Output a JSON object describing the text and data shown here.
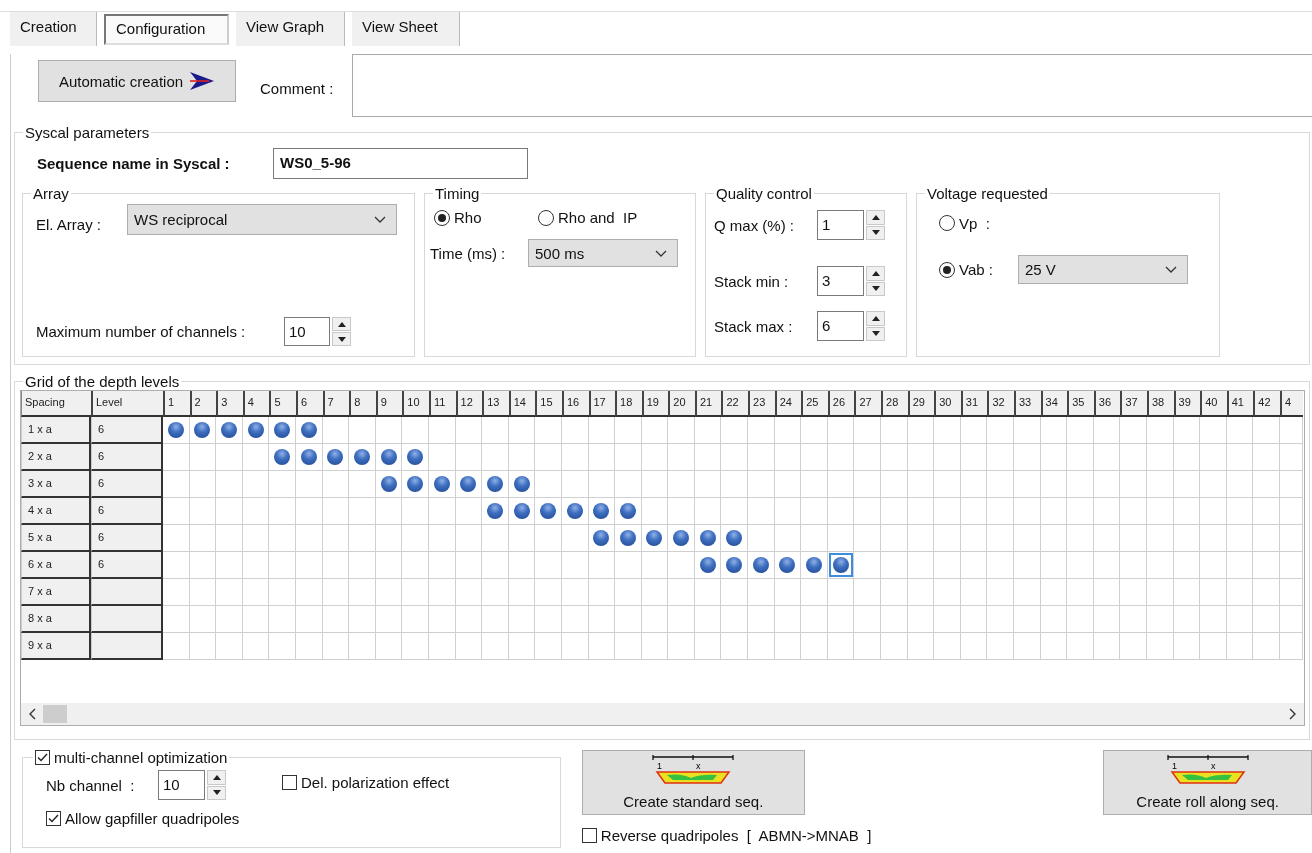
{
  "tabs": [
    {
      "label": "Creation",
      "selected": false
    },
    {
      "label": "Configuration",
      "selected": true
    },
    {
      "label": "View Graph",
      "selected": false
    },
    {
      "label": "View Sheet",
      "selected": false
    }
  ],
  "automatic_button": {
    "label": "Automatic creation"
  },
  "comment": {
    "label": "Comment :"
  },
  "syscal": {
    "title": "Syscal parameters",
    "sequence_label": "Sequence name in Syscal :",
    "sequence_value": "WS0_5-96",
    "array": {
      "title": "Array",
      "el_array_label": "El. Array :",
      "el_array_value": "WS reciprocal",
      "max_channels_label": "Maximum number of channels :",
      "max_channels_value": "10"
    },
    "timing": {
      "title": "Timing",
      "options": [
        {
          "label": "Rho",
          "selected": true
        },
        {
          "label": "Rho and  IP",
          "selected": false
        }
      ],
      "time_label": "Time (ms) :",
      "time_value": "500 ms"
    },
    "quality": {
      "title": "Quality control",
      "fields": [
        {
          "label": "Q max (%) :",
          "value": "1"
        },
        {
          "label": "Stack min :",
          "value": "3"
        },
        {
          "label": "Stack max :",
          "value": "6"
        }
      ]
    },
    "voltage": {
      "title": "Voltage requested",
      "options": [
        {
          "label": "Vp  :",
          "selected": false
        },
        {
          "label": "Vab :",
          "selected": true
        }
      ],
      "vab_value": "25 V"
    }
  },
  "grid": {
    "title": "Grid of the depth levels",
    "columns": [
      "Spacing",
      "Level",
      "1",
      "2",
      "3",
      "4",
      "5",
      "6",
      "7",
      "8",
      "9",
      "10",
      "11",
      "12",
      "13",
      "14",
      "15",
      "16",
      "17",
      "18",
      "19",
      "20",
      "21",
      "22",
      "23",
      "24",
      "25",
      "26",
      "27",
      "28",
      "29",
      "30",
      "31",
      "32",
      "33",
      "34",
      "35",
      "36",
      "37",
      "38",
      "39",
      "40",
      "41",
      "42",
      "4"
    ],
    "rows": [
      {
        "spacing": "1 x a",
        "level": "6",
        "dots": [
          true,
          true,
          true,
          true,
          true,
          true,
          false,
          false,
          false,
          false,
          false,
          false,
          false,
          false,
          false,
          false,
          false,
          false,
          false,
          false,
          false,
          false,
          false,
          false,
          false,
          false,
          false,
          false,
          false,
          false,
          false,
          false,
          false,
          false,
          false,
          false,
          false,
          false,
          false,
          false,
          false,
          false,
          false
        ],
        "selected": [
          false,
          false,
          false,
          false,
          false,
          false,
          false,
          false,
          false,
          false,
          false,
          false,
          false,
          false,
          false,
          false,
          false,
          false,
          false,
          false,
          false,
          false,
          false,
          false,
          false,
          false,
          false,
          false,
          false,
          false,
          false,
          false,
          false,
          false,
          false,
          false,
          false,
          false,
          false,
          false,
          false,
          false,
          false
        ]
      },
      {
        "spacing": "2 x a",
        "level": "6",
        "dots": [
          false,
          false,
          false,
          false,
          true,
          true,
          true,
          true,
          true,
          true,
          false,
          false,
          false,
          false,
          false,
          false,
          false,
          false,
          false,
          false,
          false,
          false,
          false,
          false,
          false,
          false,
          false,
          false,
          false,
          false,
          false,
          false,
          false,
          false,
          false,
          false,
          false,
          false,
          false,
          false,
          false,
          false,
          false
        ],
        "selected": [
          false,
          false,
          false,
          false,
          false,
          false,
          false,
          false,
          false,
          false,
          false,
          false,
          false,
          false,
          false,
          false,
          false,
          false,
          false,
          false,
          false,
          false,
          false,
          false,
          false,
          false,
          false,
          false,
          false,
          false,
          false,
          false,
          false,
          false,
          false,
          false,
          false,
          false,
          false,
          false,
          false,
          false,
          false
        ]
      },
      {
        "spacing": "3 x a",
        "level": "6",
        "dots": [
          false,
          false,
          false,
          false,
          false,
          false,
          false,
          false,
          true,
          true,
          true,
          true,
          true,
          true,
          false,
          false,
          false,
          false,
          false,
          false,
          false,
          false,
          false,
          false,
          false,
          false,
          false,
          false,
          false,
          false,
          false,
          false,
          false,
          false,
          false,
          false,
          false,
          false,
          false,
          false,
          false,
          false,
          false
        ],
        "selected": [
          false,
          false,
          false,
          false,
          false,
          false,
          false,
          false,
          false,
          false,
          false,
          false,
          false,
          false,
          false,
          false,
          false,
          false,
          false,
          false,
          false,
          false,
          false,
          false,
          false,
          false,
          false,
          false,
          false,
          false,
          false,
          false,
          false,
          false,
          false,
          false,
          false,
          false,
          false,
          false,
          false,
          false,
          false
        ]
      },
      {
        "spacing": "4 x a",
        "level": "6",
        "dots": [
          false,
          false,
          false,
          false,
          false,
          false,
          false,
          false,
          false,
          false,
          false,
          false,
          true,
          true,
          true,
          true,
          true,
          true,
          false,
          false,
          false,
          false,
          false,
          false,
          false,
          false,
          false,
          false,
          false,
          false,
          false,
          false,
          false,
          false,
          false,
          false,
          false,
          false,
          false,
          false,
          false,
          false,
          false
        ],
        "selected": [
          false,
          false,
          false,
          false,
          false,
          false,
          false,
          false,
          false,
          false,
          false,
          false,
          false,
          false,
          false,
          false,
          false,
          false,
          false,
          false,
          false,
          false,
          false,
          false,
          false,
          false,
          false,
          false,
          false,
          false,
          false,
          false,
          false,
          false,
          false,
          false,
          false,
          false,
          false,
          false,
          false,
          false,
          false
        ]
      },
      {
        "spacing": "5 x a",
        "level": "6",
        "dots": [
          false,
          false,
          false,
          false,
          false,
          false,
          false,
          false,
          false,
          false,
          false,
          false,
          false,
          false,
          false,
          false,
          true,
          true,
          true,
          true,
          true,
          true,
          false,
          false,
          false,
          false,
          false,
          false,
          false,
          false,
          false,
          false,
          false,
          false,
          false,
          false,
          false,
          false,
          false,
          false,
          false,
          false,
          false
        ],
        "selected": [
          false,
          false,
          false,
          false,
          false,
          false,
          false,
          false,
          false,
          false,
          false,
          false,
          false,
          false,
          false,
          false,
          false,
          false,
          false,
          false,
          false,
          false,
          false,
          false,
          false,
          false,
          false,
          false,
          false,
          false,
          false,
          false,
          false,
          false,
          false,
          false,
          false,
          false,
          false,
          false,
          false,
          false,
          false
        ]
      },
      {
        "spacing": "6 x a",
        "level": "6",
        "dots": [
          false,
          false,
          false,
          false,
          false,
          false,
          false,
          false,
          false,
          false,
          false,
          false,
          false,
          false,
          false,
          false,
          false,
          false,
          false,
          false,
          true,
          true,
          true,
          true,
          true,
          true,
          false,
          false,
          false,
          false,
          false,
          false,
          false,
          false,
          false,
          false,
          false,
          false,
          false,
          false,
          false,
          false,
          false
        ],
        "selected": [
          false,
          false,
          false,
          false,
          false,
          false,
          false,
          false,
          false,
          false,
          false,
          false,
          false,
          false,
          false,
          false,
          false,
          false,
          false,
          false,
          false,
          false,
          false,
          false,
          false,
          true,
          false,
          false,
          false,
          false,
          false,
          false,
          false,
          false,
          false,
          false,
          false,
          false,
          false,
          false,
          false,
          false,
          false
        ]
      },
      {
        "spacing": "7 x a",
        "dots": [
          false,
          false,
          false,
          false,
          false,
          false,
          false,
          false,
          false,
          false,
          false,
          false,
          false,
          false,
          false,
          false,
          false,
          false,
          false,
          false,
          false,
          false,
          false,
          false,
          false,
          false,
          false,
          false,
          false,
          false,
          false,
          false,
          false,
          false,
          false,
          false,
          false,
          false,
          false,
          false,
          false,
          false,
          false
        ],
        "selected": [
          false,
          false,
          false,
          false,
          false,
          false,
          false,
          false,
          false,
          false,
          false,
          false,
          false,
          false,
          false,
          false,
          false,
          false,
          false,
          false,
          false,
          false,
          false,
          false,
          false,
          false,
          false,
          false,
          false,
          false,
          false,
          false,
          false,
          false,
          false,
          false,
          false,
          false,
          false,
          false,
          false,
          false,
          false
        ]
      },
      {
        "spacing": "8 x a",
        "dots": [
          false,
          false,
          false,
          false,
          false,
          false,
          false,
          false,
          false,
          false,
          false,
          false,
          false,
          false,
          false,
          false,
          false,
          false,
          false,
          false,
          false,
          false,
          false,
          false,
          false,
          false,
          false,
          false,
          false,
          false,
          false,
          false,
          false,
          false,
          false,
          false,
          false,
          false,
          false,
          false,
          false,
          false,
          false
        ],
        "selected": [
          false,
          false,
          false,
          false,
          false,
          false,
          false,
          false,
          false,
          false,
          false,
          false,
          false,
          false,
          false,
          false,
          false,
          false,
          false,
          false,
          false,
          false,
          false,
          false,
          false,
          false,
          false,
          false,
          false,
          false,
          false,
          false,
          false,
          false,
          false,
          false,
          false,
          false,
          false,
          false,
          false,
          false,
          false
        ]
      },
      {
        "spacing": "9 x a",
        "dots": [
          false,
          false,
          false,
          false,
          false,
          false,
          false,
          false,
          false,
          false,
          false,
          false,
          false,
          false,
          false,
          false,
          false,
          false,
          false,
          false,
          false,
          false,
          false,
          false,
          false,
          false,
          false,
          false,
          false,
          false,
          false,
          false,
          false,
          false,
          false,
          false,
          false,
          false,
          false,
          false,
          false,
          false,
          false
        ],
        "selected": [
          false,
          false,
          false,
          false,
          false,
          false,
          false,
          false,
          false,
          false,
          false,
          false,
          false,
          false,
          false,
          false,
          false,
          false,
          false,
          false,
          false,
          false,
          false,
          false,
          false,
          false,
          false,
          false,
          false,
          false,
          false,
          false,
          false,
          false,
          false,
          false,
          false,
          false,
          false,
          false,
          false,
          false,
          false
        ]
      }
    ]
  },
  "bottom": {
    "optimization": {
      "label": "multi-channel optimization",
      "checked": true
    },
    "nb_channel_label": "Nb channel  :",
    "nb_channel_value": "10",
    "del_polarization": {
      "label": "Del. polarization effect",
      "checked": false
    },
    "gapfiller": {
      "label": "Allow gapfiller quadripoles",
      "checked": true
    },
    "standard_button": {
      "label": "Create standard seq.",
      "scale_labels": [
        "1",
        "x"
      ]
    },
    "reverse": {
      "label": "Reverse quadripoles  [  ABMN->MNAB  ]",
      "checked": false
    },
    "roll_button": {
      "label": "Create roll along seq.",
      "scale_labels": [
        "1",
        "x"
      ]
    }
  }
}
